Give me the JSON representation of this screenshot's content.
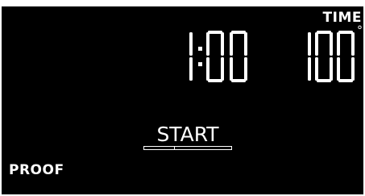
{
  "display": {
    "time_label": "TIME",
    "timer": "1:00",
    "temperature": "100",
    "temperature_unit": "°",
    "start_label": "START",
    "mode_label": "PROOF"
  },
  "colors": {
    "background": "#000000",
    "foreground": "#ffffff",
    "frame": "#ffffff"
  }
}
